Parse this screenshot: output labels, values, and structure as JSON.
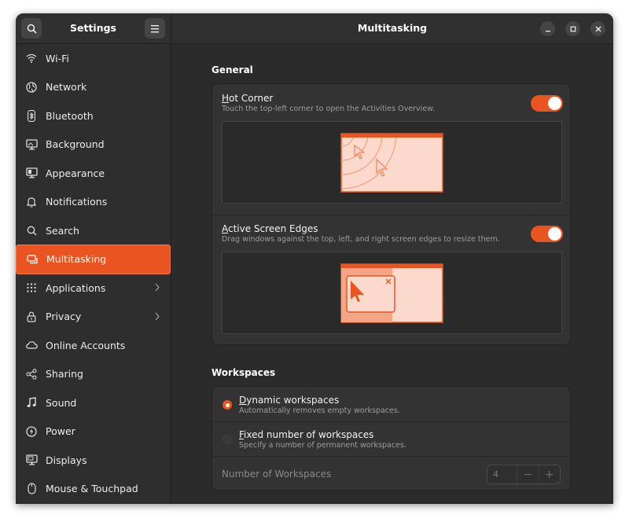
{
  "sidebar": {
    "title": "Settings",
    "items": [
      {
        "label": "Wi-Fi",
        "icon": "wifi-icon"
      },
      {
        "label": "Network",
        "icon": "globe-icon"
      },
      {
        "label": "Bluetooth",
        "icon": "bluetooth-icon"
      },
      {
        "label": "Background",
        "icon": "monitor-icon"
      },
      {
        "label": "Appearance",
        "icon": "appearance-icon"
      },
      {
        "label": "Notifications",
        "icon": "bell-icon"
      },
      {
        "label": "Search",
        "icon": "search-icon"
      },
      {
        "label": "Multitasking",
        "icon": "multitasking-icon",
        "active": true
      },
      {
        "label": "Applications",
        "icon": "grid-icon",
        "chevron": true
      },
      {
        "label": "Privacy",
        "icon": "lock-icon",
        "chevron": true
      },
      {
        "label": "Online Accounts",
        "icon": "cloud-icon"
      },
      {
        "label": "Sharing",
        "icon": "share-icon"
      },
      {
        "label": "Sound",
        "icon": "music-note-icon"
      },
      {
        "label": "Power",
        "icon": "power-icon"
      },
      {
        "label": "Displays",
        "icon": "display-icon"
      },
      {
        "label": "Mouse & Touchpad",
        "icon": "mouse-icon"
      }
    ]
  },
  "header": {
    "title": "Multitasking"
  },
  "general": {
    "title": "General",
    "hot_corner": {
      "title_first": "H",
      "title_rest": "ot Corner",
      "subtitle": "Touch the top-left corner to open the Activities Overview.",
      "enabled": true
    },
    "edges": {
      "title_first": "A",
      "title_rest": "ctive Screen Edges",
      "subtitle": "Drag windows against the top, left, and right screen edges to resize them.",
      "enabled": true
    }
  },
  "workspaces": {
    "title": "Workspaces",
    "dynamic": {
      "title_first": "D",
      "title_rest": "ynamic workspaces",
      "subtitle": "Automatically removes empty workspaces.",
      "selected": true
    },
    "fixed": {
      "title_first": "F",
      "title_rest": "ixed number of workspaces",
      "subtitle": "Specify a number of permanent workspaces.",
      "selected": false
    },
    "number": {
      "label": "Number of Workspaces",
      "value": "4",
      "minus": "−",
      "plus": "+"
    }
  },
  "colors": {
    "accent": "#e95420",
    "accent_light": "#fbd9cc"
  }
}
